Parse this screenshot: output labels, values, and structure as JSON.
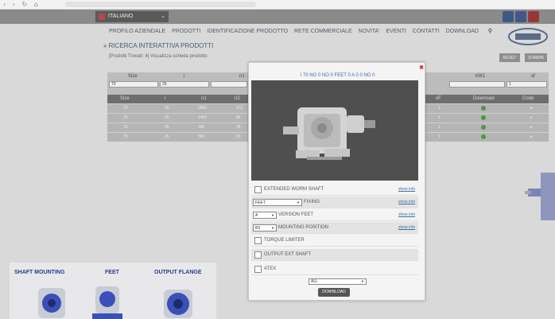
{
  "browser": {
    "nav": "‹ › ↻ ⌂"
  },
  "site": {
    "language": "ITALIANO",
    "menu": [
      "PROFILO AZIENDALE",
      "PRODOTTI",
      "IDENTIFICAZIONE PRODOTTO",
      "RETE COMMERCIALE",
      "NOVITA'",
      "EVENTI",
      "CONTATTI",
      "DOWNLOAD"
    ],
    "section_title": "» RICERCA INTERATTIVA PRODOTTI",
    "products_found": "[Prodotti Trovati: 4] Visualizza scheda prodotto",
    "reset_label": "RESET",
    "print_label": "STAMPA",
    "filters": [
      {
        "label": "Size",
        "value": "70"
      },
      {
        "label": "i",
        "value": "25"
      },
      {
        "label": "n1",
        "value": ""
      },
      {
        "label": "kW1",
        "value": ""
      },
      {
        "label": "sf",
        "value": "1"
      }
    ],
    "table": {
      "headers": [
        "Size",
        "i",
        "n1",
        "n2",
        "sF",
        "Download",
        "Code"
      ],
      "rows": [
        [
          "70",
          "25",
          "2800",
          "112",
          "1"
        ],
        [
          "70",
          "25",
          "1400",
          "56",
          "1"
        ],
        [
          "70",
          "25",
          "900",
          "36",
          "1"
        ],
        [
          "70",
          "25",
          "500",
          "20",
          "1"
        ]
      ]
    },
    "promo": {
      "shaft_mounting": "SHAFT MOUNTING",
      "feet": "FEET",
      "output_flange": "OUTPUT FLANGE"
    }
  },
  "modal": {
    "close": "✖",
    "model_code": "I 70 NO 0 NO 0 FEET 0 A 0 0 NO 0",
    "options": {
      "extended_worm_shaft": "EXTENDED WORM SHAFT",
      "fixing_value": "FEET",
      "fixing_label": "FIXING",
      "version_value": "A",
      "version_label": "VERSION FEET",
      "mounting_value": "B3",
      "mounting_label": "MOUNTING POSITION",
      "torque_limiter": "TORQUE LIMITER",
      "output_ext_shaft": "OUTPUT EXT SHAFT",
      "atex": "ATEX"
    },
    "show_info": "show info",
    "bottom_select": "ALL",
    "download_label": "DOWNLOAD"
  },
  "colors": {
    "accent_blue": "#3c6ea8",
    "promo_blue": "#233d8a",
    "close_red": "#c0392b"
  }
}
